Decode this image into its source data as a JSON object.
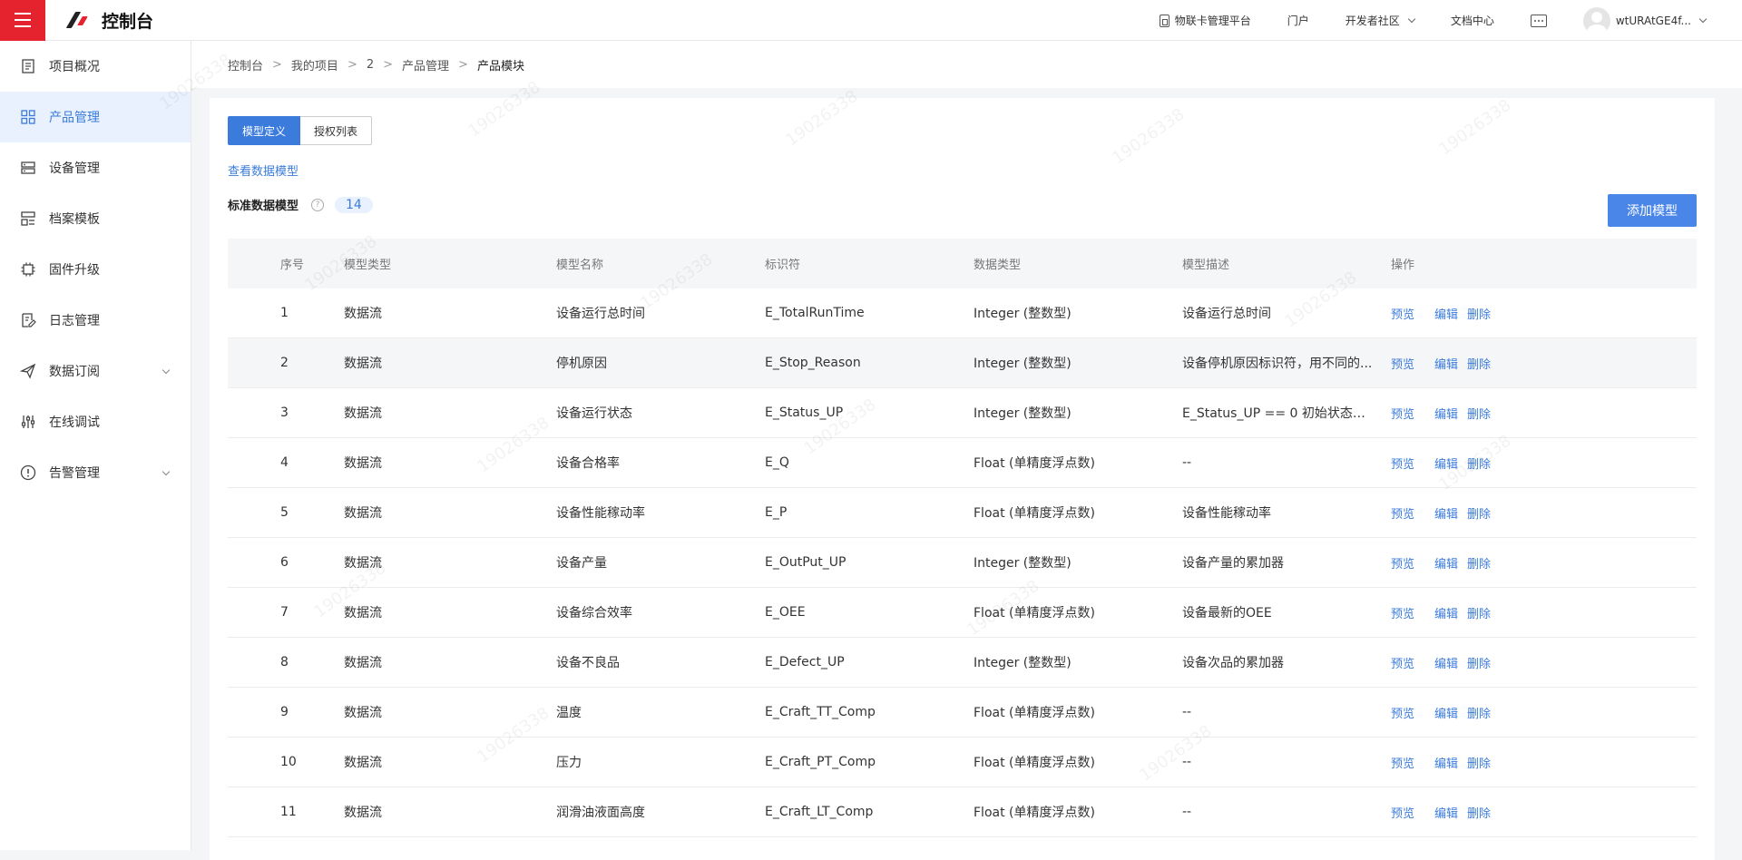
{
  "header": {
    "app_title": "控制台",
    "links": {
      "iot_card": "物联卡管理平台",
      "portal": "门户",
      "dev_community": "开发者社区",
      "docs": "文档中心"
    },
    "username": "wtURAtGE4f..."
  },
  "sidebar": {
    "items": [
      {
        "label": "项目概况",
        "icon": "document-icon"
      },
      {
        "label": "产品管理",
        "icon": "grid-icon",
        "active": true
      },
      {
        "label": "设备管理",
        "icon": "server-icon"
      },
      {
        "label": "档案模板",
        "icon": "template-icon"
      },
      {
        "label": "固件升级",
        "icon": "chip-icon"
      },
      {
        "label": "日志管理",
        "icon": "log-icon"
      },
      {
        "label": "数据订阅",
        "icon": "send-icon",
        "expandable": true
      },
      {
        "label": "在线调试",
        "icon": "sliders-icon"
      },
      {
        "label": "告警管理",
        "icon": "alert-icon",
        "expandable": true
      }
    ]
  },
  "breadcrumb": [
    "控制台",
    "我的项目",
    "2",
    "产品管理",
    "产品模块"
  ],
  "tabs": [
    "模型定义",
    "授权列表"
  ],
  "view_data_model": "查看数据模型",
  "section": {
    "title": "标准数据模型",
    "count": "14",
    "add_button": "添加模型"
  },
  "table": {
    "headers": [
      "序号",
      "模型类型",
      "模型名称",
      "标识符",
      "数据类型",
      "模型描述",
      "操作"
    ],
    "actions": [
      "预览",
      "编辑",
      "删除"
    ],
    "rows": [
      [
        "1",
        "数据流",
        "设备运行总时间",
        "E_TotalRunTime",
        "Integer (整数型)",
        "设备运行总时间"
      ],
      [
        "2",
        "数据流",
        "停机原因",
        "E_Stop_Reason",
        "Integer (整数型)",
        "设备停机原因标识符，用不同的..."
      ],
      [
        "3",
        "数据流",
        "设备运行状态",
        "E_Status_UP",
        "Integer (整数型)",
        "E_Status_UP == 0 初始状态（..."
      ],
      [
        "4",
        "数据流",
        "设备合格率",
        "E_Q",
        "Float (单精度浮点数)",
        "--"
      ],
      [
        "5",
        "数据流",
        "设备性能稼动率",
        "E_P",
        "Float (单精度浮点数)",
        "设备性能稼动率"
      ],
      [
        "6",
        "数据流",
        "设备产量",
        "E_OutPut_UP",
        "Integer (整数型)",
        "设备产量的累加器"
      ],
      [
        "7",
        "数据流",
        "设备综合效率",
        "E_OEE",
        "Float (单精度浮点数)",
        "设备最新的OEE"
      ],
      [
        "8",
        "数据流",
        "设备不良品",
        "E_Defect_UP",
        "Integer (整数型)",
        "设备次品的累加器"
      ],
      [
        "9",
        "数据流",
        "温度",
        "E_Craft_TT_Comp",
        "Float (单精度浮点数)",
        "--"
      ],
      [
        "10",
        "数据流",
        "压力",
        "E_Craft_PT_Comp",
        "Float (单精度浮点数)",
        "--"
      ],
      [
        "11",
        "数据流",
        "润滑油液面高度",
        "E_Craft_LT_Comp",
        "Float (单精度浮点数)",
        "--"
      ]
    ]
  }
}
